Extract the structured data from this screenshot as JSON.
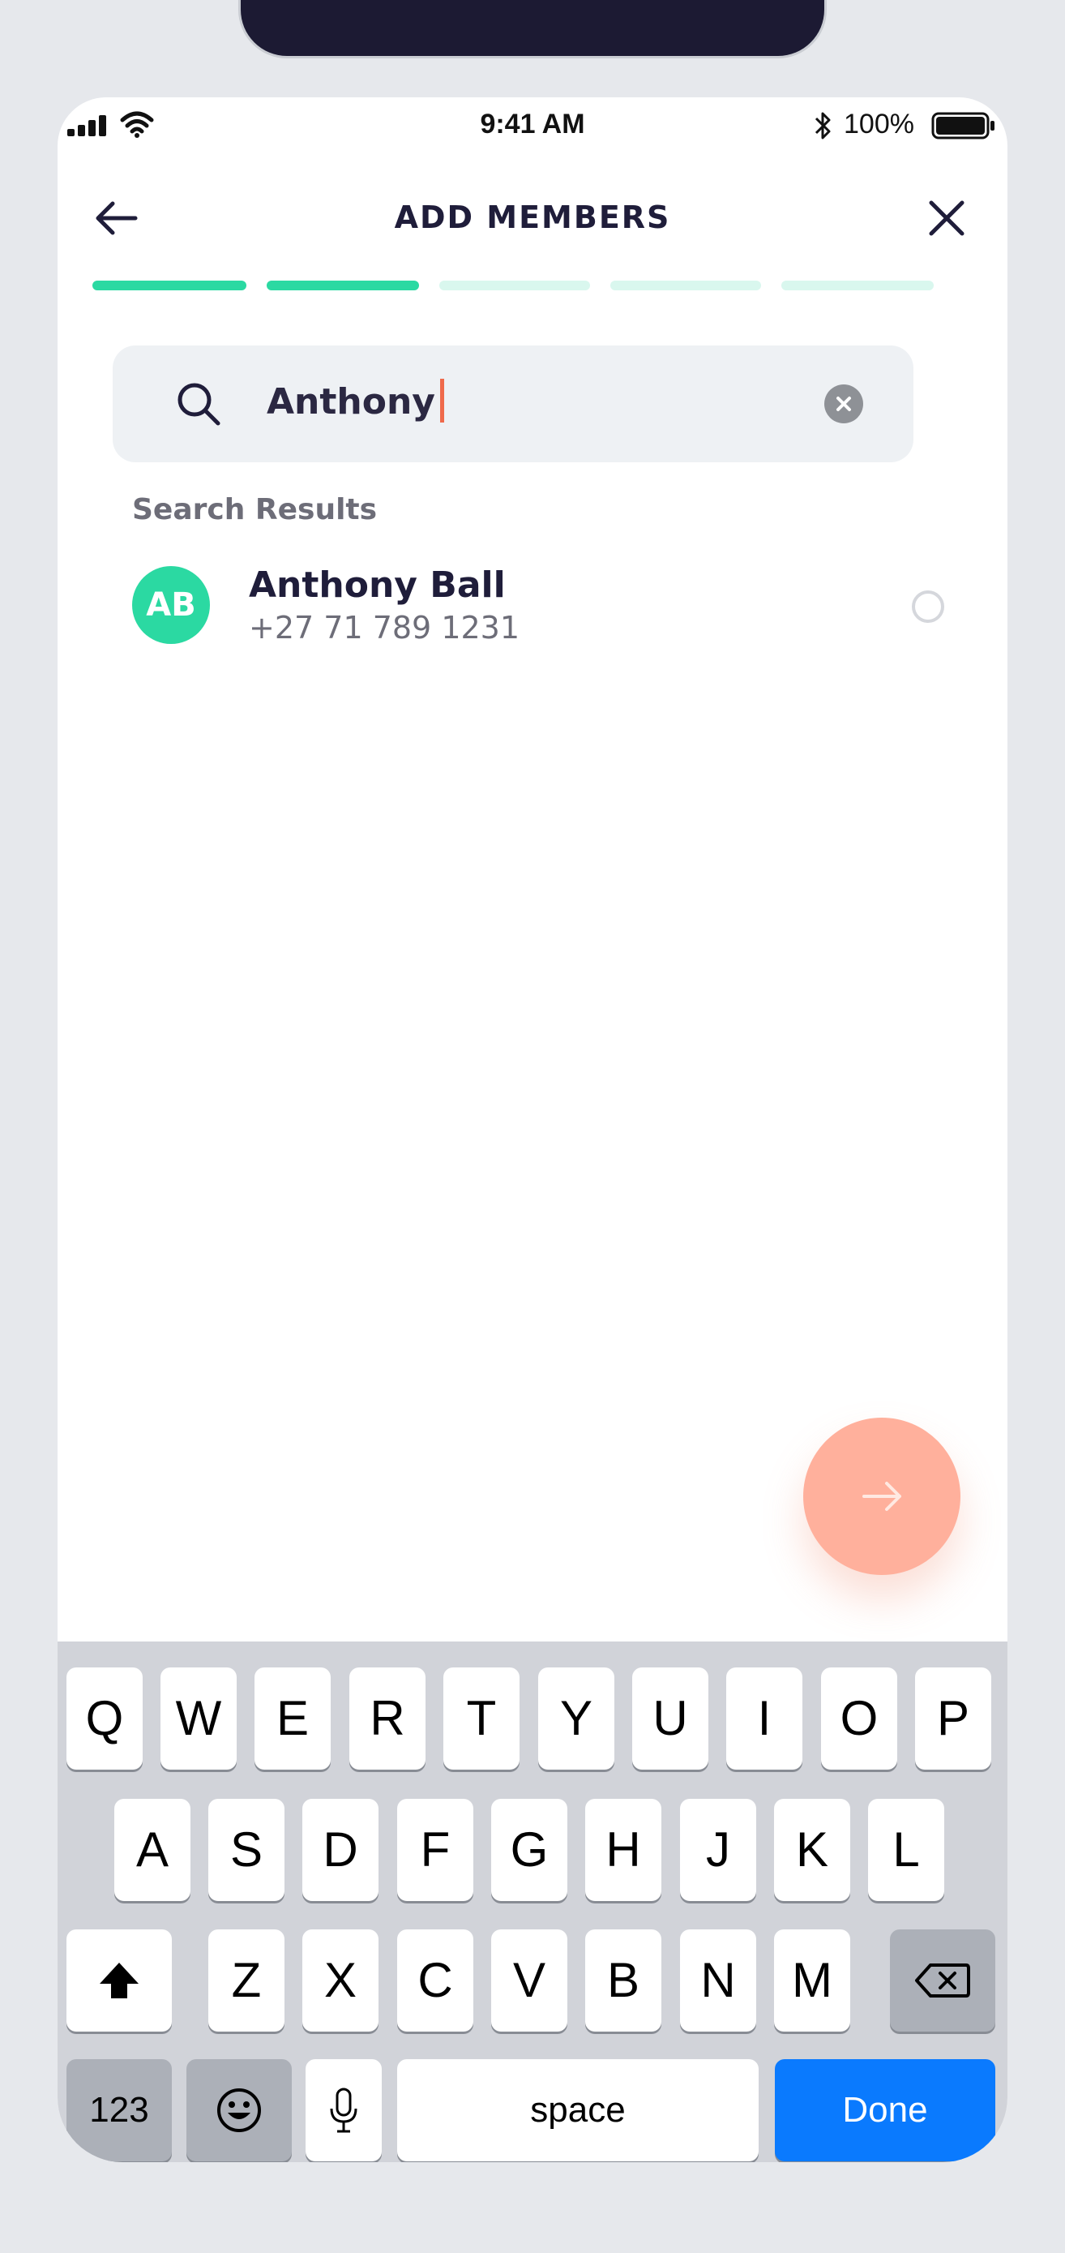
{
  "status_bar": {
    "time": "9:41 AM",
    "battery": "100%"
  },
  "header": {
    "title": "ADD MEMBERS"
  },
  "progress": {
    "total_steps": 5,
    "current_step": 2,
    "active_color": "#2bd9a2",
    "inactive_color": "#d9f7ee"
  },
  "search": {
    "value": "Anthony"
  },
  "results": {
    "label": "Search Results",
    "items": [
      {
        "initials": "AB",
        "name": "Anthony Ball",
        "phone": "+27 71 789 1231",
        "selected": false
      }
    ]
  },
  "keyboard": {
    "row1": [
      "Q",
      "W",
      "E",
      "R",
      "T",
      "Y",
      "U",
      "I",
      "O",
      "P"
    ],
    "row2": [
      "A",
      "S",
      "D",
      "F",
      "G",
      "H",
      "J",
      "K",
      "L"
    ],
    "row3": [
      "Z",
      "X",
      "C",
      "V",
      "B",
      "N",
      "M"
    ],
    "numbers_label": "123",
    "space_label": "space",
    "done_label": "Done"
  },
  "colors": {
    "accent": "#2bd9a2",
    "fab": "#ffb09c",
    "caret": "#ef6a4b",
    "done_key": "#0a7afe"
  }
}
